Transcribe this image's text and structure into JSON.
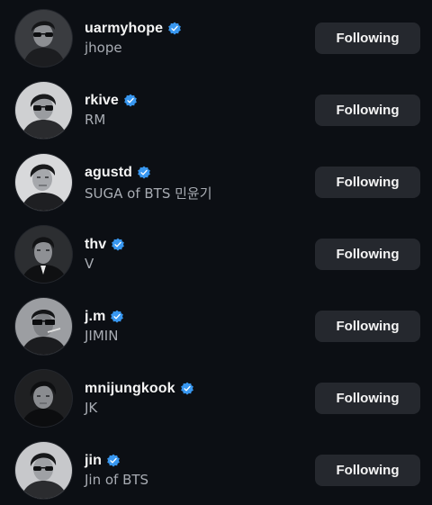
{
  "following_list": {
    "button_label": "Following",
    "verified_badge_color": "#3897f0",
    "accounts": [
      {
        "username": "uarmyhope",
        "full_name": "jhope",
        "verified": true
      },
      {
        "username": "rkive",
        "full_name": "RM",
        "verified": true
      },
      {
        "username": "agustd",
        "full_name": "SUGA of BTS 민윤기",
        "verified": true
      },
      {
        "username": "thv",
        "full_name": "V",
        "verified": true
      },
      {
        "username": "j.m",
        "full_name": "JIMIN",
        "verified": true
      },
      {
        "username": "mnijungkook",
        "full_name": "JK",
        "verified": true
      },
      {
        "username": "jin",
        "full_name": "Jin of BTS",
        "verified": true
      }
    ]
  }
}
